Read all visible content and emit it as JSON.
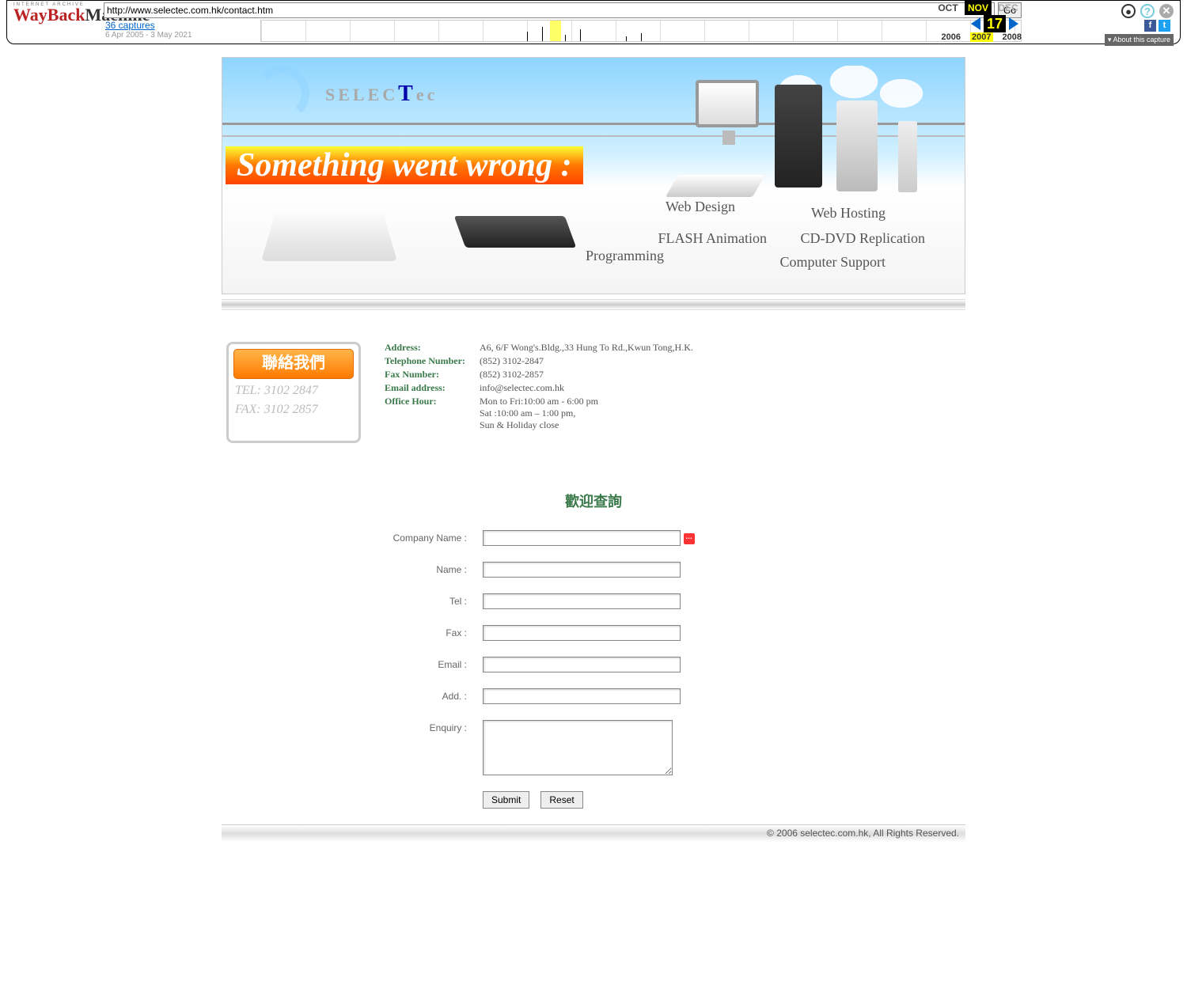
{
  "wayback": {
    "archive_label": "INTERNET ARCHIVE",
    "url": "http://www.selectec.com.hk/contact.htm",
    "go": "Go",
    "captures_link": "36 captures",
    "date_range": "6 Apr 2005 - 3 May 2021",
    "months": {
      "prev": "OCT",
      "cur": "NOV",
      "next": "DEC"
    },
    "day": "17",
    "years": {
      "prev": "2006",
      "cur": "2007",
      "next": "2008"
    },
    "about": "About this capture"
  },
  "banner": {
    "brand": "SELECTec",
    "error": "Something went wrong :",
    "services": {
      "web": "Web Design",
      "host": "Web Hosting",
      "flash": "FLASH Animation",
      "cd": "CD-DVD Replication",
      "prog": "Programming",
      "supp": "Computer Support"
    }
  },
  "sidecard": {
    "button": "聯絡我們",
    "tel": "TEL: 3102 2847",
    "fax": "FAX: 3102 2857"
  },
  "info": {
    "labels": {
      "address": "Address:",
      "phone": "Telephone Number:",
      "fax": "Fax Number:",
      "email": "Email address:",
      "hours": "Office Hour:"
    },
    "address": "A6, 6/F Wong's.Bldg.,33 Hung To Rd.,Kwun Tong,H.K.",
    "phone": "(852) 3102-2847",
    "fax": "(852) 3102-2857",
    "email": "info@selectec.com.hk",
    "hours1": "Mon to Fri:10:00 am - 6:00 pm",
    "hours2": "Sat :10:00 am – 1:00 pm,",
    "hours3": "Sun & Holiday close"
  },
  "form": {
    "title": "歡迎查詢",
    "labels": {
      "company": "Company Name :",
      "name": "Name :",
      "tel": "Tel :",
      "fax": "Fax :",
      "email": "Email :",
      "add": "Add. :",
      "enquiry": "Enquiry :"
    },
    "submit": "Submit",
    "reset": "Reset"
  },
  "footer": "© 2006 selectec.com.hk, All Rights Reserved."
}
